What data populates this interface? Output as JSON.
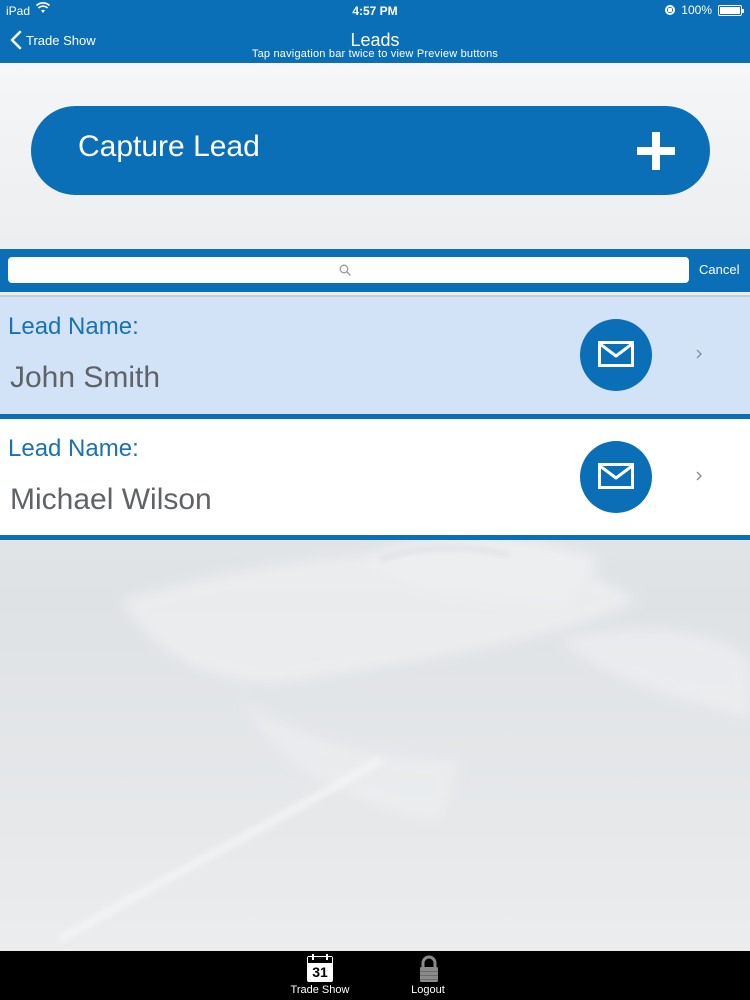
{
  "status_bar": {
    "carrier": "iPad",
    "time": "4:57 PM",
    "battery": "100%"
  },
  "nav": {
    "back_label": "Trade Show",
    "title": "Leads",
    "subtitle": "Tap navigation bar twice to view Preview buttons"
  },
  "capture": {
    "label": "Capture Lead"
  },
  "search": {
    "value": "",
    "placeholder": "",
    "cancel_label": "Cancel"
  },
  "leads": [
    {
      "field_label": "Lead Name:",
      "name": "John Smith",
      "selected": true
    },
    {
      "field_label": "Lead Name:",
      "name": "Michael Wilson",
      "selected": false
    }
  ],
  "tabbar": {
    "tabs": [
      {
        "label": "Trade Show",
        "icon": "calendar-icon",
        "icon_text": "31"
      },
      {
        "label": "Logout",
        "icon": "lock-icon"
      }
    ]
  },
  "colors": {
    "accent": "#0b6fb8",
    "selected_row": "#d3e3f7",
    "label_blue": "#1a72b6",
    "name_gray": "#5f6368"
  }
}
